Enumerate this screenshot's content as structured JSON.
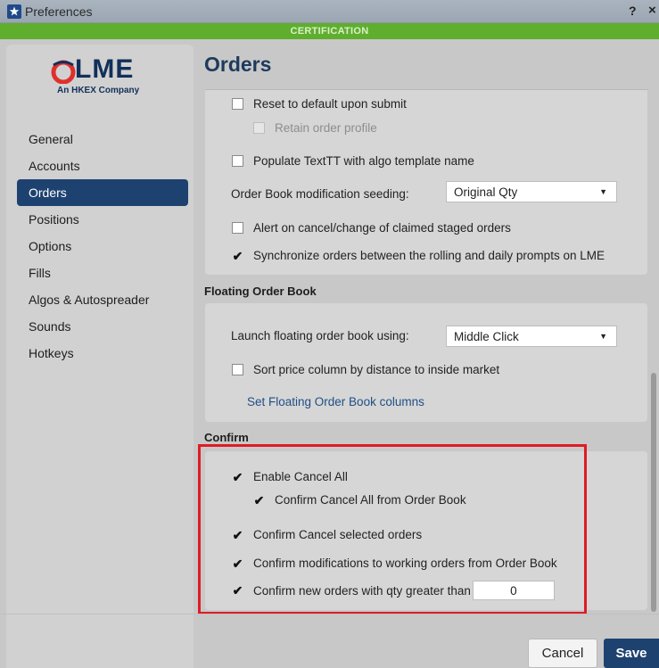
{
  "window": {
    "title": "Preferences",
    "help": "?",
    "close": "×"
  },
  "environment_banner": "CERTIFICATION",
  "logo": {
    "name": "LME",
    "tagline": "An HKEX Company"
  },
  "nav": [
    {
      "label": "General"
    },
    {
      "label": "Accounts"
    },
    {
      "label": "Orders",
      "active": true
    },
    {
      "label": "Positions"
    },
    {
      "label": "Options"
    },
    {
      "label": "Fills"
    },
    {
      "label": "Algos & Autospreader"
    },
    {
      "label": "Sounds"
    },
    {
      "label": "Hotkeys"
    }
  ],
  "page_title": "Orders",
  "orders_section": {
    "reset_default": {
      "label": "Reset to default upon submit",
      "checked": false
    },
    "retain_profile": {
      "label": "Retain order profile",
      "checked": false,
      "disabled": true
    },
    "populate_texttt": {
      "label": "Populate TextTT with algo template name",
      "checked": false
    },
    "seeding_label": "Order Book modification seeding:",
    "seeding_value": "Original Qty",
    "alert_cancel": {
      "label": "Alert on cancel/change of claimed staged orders",
      "checked": false
    },
    "synchronize": {
      "label": "Synchronize orders between the rolling and daily prompts on LME",
      "checked": true
    }
  },
  "floating_section": {
    "title": "Floating Order Book",
    "launch_label": "Launch floating order book using:",
    "launch_value": "Middle Click",
    "sort_price": {
      "label": "Sort price column by distance to inside market",
      "checked": false
    },
    "columns_link": "Set Floating Order Book columns"
  },
  "confirm_section": {
    "title": "Confirm",
    "enable_cancel_all": {
      "label": "Enable Cancel All",
      "checked": true
    },
    "confirm_cancel_all": {
      "label": "Confirm Cancel All from Order Book",
      "checked": true
    },
    "confirm_cancel_selected": {
      "label": "Confirm Cancel selected orders",
      "checked": true
    },
    "confirm_modifications": {
      "label": "Confirm modifications to working orders from Order Book",
      "checked": true
    },
    "confirm_new_orders": {
      "label": "Confirm new orders with qty greater than",
      "checked": true,
      "value": "0"
    }
  },
  "buttons": {
    "cancel": "Cancel",
    "save": "Save"
  },
  "colors": {
    "accent": "#1e4270",
    "banner": "#5fae2e",
    "highlight": "#e01b24"
  }
}
